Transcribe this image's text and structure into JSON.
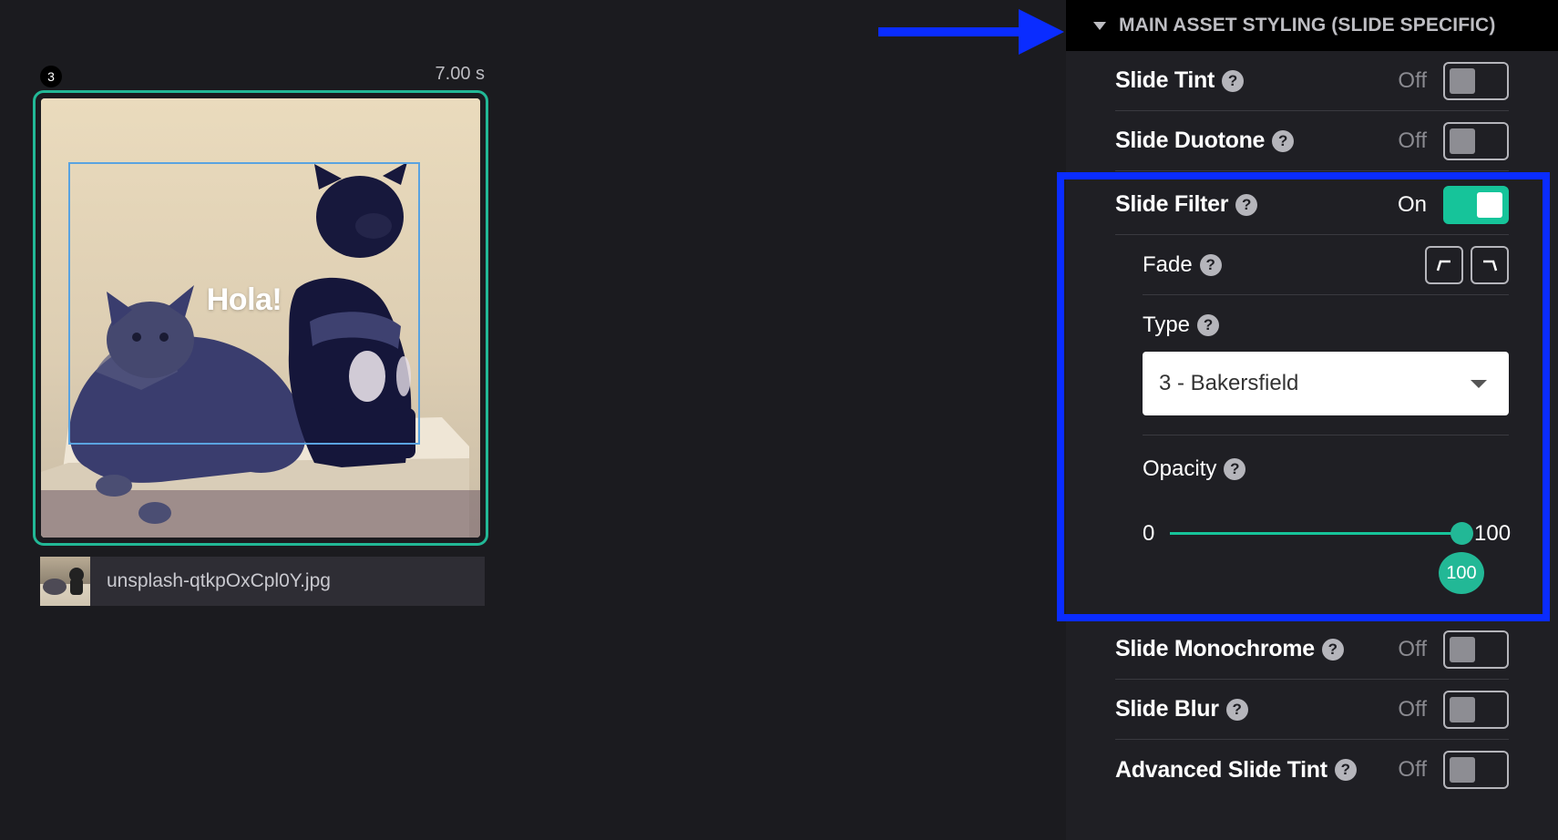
{
  "slide": {
    "number": "3",
    "duration": "7.00 s",
    "overlay_text": "Hola!",
    "file_name": "unsplash-qtkpOxCpl0Y.jpg"
  },
  "panel": {
    "section_title": "MAIN ASSET STYLING (SLIDE SPECIFIC)",
    "help_glyph": "?",
    "slide_tint": {
      "label": "Slide Tint",
      "state": "Off"
    },
    "slide_duotone": {
      "label": "Slide Duotone",
      "state": "Off"
    },
    "slide_filter": {
      "label": "Slide Filter",
      "state": "On",
      "fade_label": "Fade",
      "type_label": "Type",
      "type_value": "3 - Bakersfield",
      "opacity_label": "Opacity",
      "opacity_min": "0",
      "opacity_max": "100",
      "opacity_value": "100"
    },
    "slide_monochrome": {
      "label": "Slide Monochrome",
      "state": "Off"
    },
    "slide_blur": {
      "label": "Slide Blur",
      "state": "Off"
    },
    "advanced_slide_tint": {
      "label": "Advanced Slide Tint",
      "state": "Off"
    }
  },
  "colors": {
    "accent": "#16c49a",
    "annotation_blue": "#0a2cff",
    "background": "#1b1b1f"
  },
  "icons": {
    "fade_in": "fade-in-icon",
    "fade_out": "fade-out-icon",
    "collapse": "caret-down-icon",
    "annotation_arrow": "arrow-right-icon"
  }
}
